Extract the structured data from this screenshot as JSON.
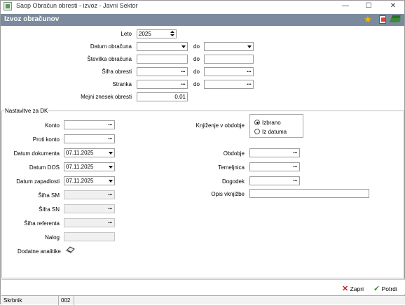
{
  "window": {
    "title": "Saop Obračun obresti - izvoz - Javni Sektor",
    "min_glyph": "—",
    "max_glyph": "☐",
    "close_glyph": "✕"
  },
  "header": {
    "title": "Izvoz obračunov"
  },
  "top": {
    "leto_label": "Leto",
    "leto_value": "2025",
    "datum_obracuna_label": "Datum obračuna",
    "do": "do",
    "stevilka_label": "Številka obračuna",
    "sifra_obresti_label": "Šifra obresti",
    "stranka_label": "Stranka",
    "mejni_label": "Mejni znesek obresti",
    "mejni_value": "0,01",
    "ellipsis": "..."
  },
  "dk": {
    "group_title": "Nastavitve za DK",
    "konto_label": "Konto",
    "proti_konto_label": "Proti konto",
    "datum_dokumenta_label": "Datum dokumenta",
    "datum_dokumenta_value": "07.11.2025",
    "datum_dos_label": "Datum DOS",
    "datum_dos_value": "07.11.2025",
    "datum_zapadlosti_label": "Datum zapadlosti",
    "datum_zapadlosti_value": "07.11.2025",
    "sifra_sm_label": "Šifra SM",
    "sifra_sn_label": "Šifra SN",
    "sifra_referenta_label": "Šifra referenta",
    "nalog_label": "Nalog",
    "dodatne_label": "Dodatne analitike",
    "knjizenje_label": "Knjiženje v obdobje",
    "radio_izbrano": "Izbrano",
    "radio_iz_datuma": "Iz datuma",
    "obdobje_label": "Obdobje",
    "temeljnica_label": "Temeljnica",
    "dogodek_label": "Dogodek",
    "opis_label": "Opis vknjižbe"
  },
  "actions": {
    "zapri": "Zapri",
    "potrdi": "Potrdi"
  },
  "status": {
    "user": "Skrbnik",
    "code": "002"
  },
  "colors": {
    "header": "#7b8a9c",
    "accent_red": "#cc2222",
    "accent_green": "#2e8b2e"
  }
}
